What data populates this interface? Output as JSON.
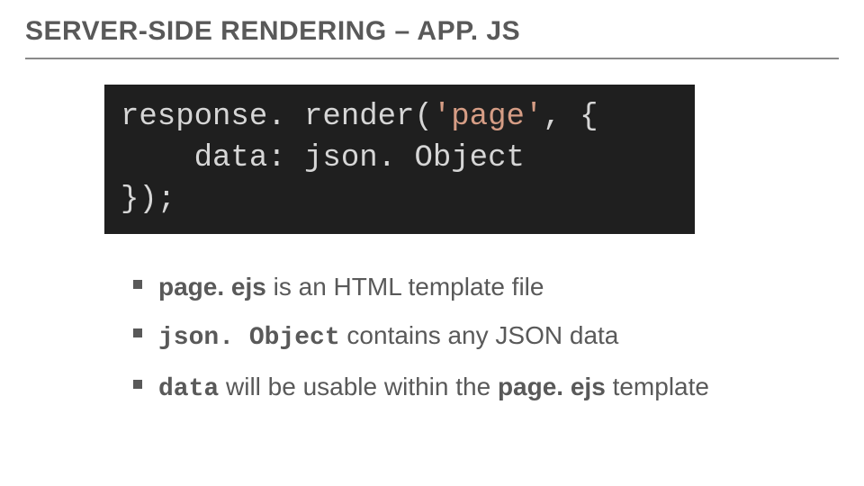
{
  "title": "SERVER-SIDE RENDERING – APP. JS",
  "code": {
    "l1a": "response. render(",
    "l1b": "'page'",
    "l1c": ", {",
    "l2": "    data: json. Object",
    "l3": "});"
  },
  "bullets": [
    {
      "strong": "page. ejs",
      "rest": " is an HTML template file"
    },
    {
      "strong": "json. Object",
      "rest": " contains any JSON data"
    },
    {
      "strong": "data",
      "mid": " will be usable within the ",
      "strong2": "page. ejs",
      "rest2": " template"
    }
  ]
}
